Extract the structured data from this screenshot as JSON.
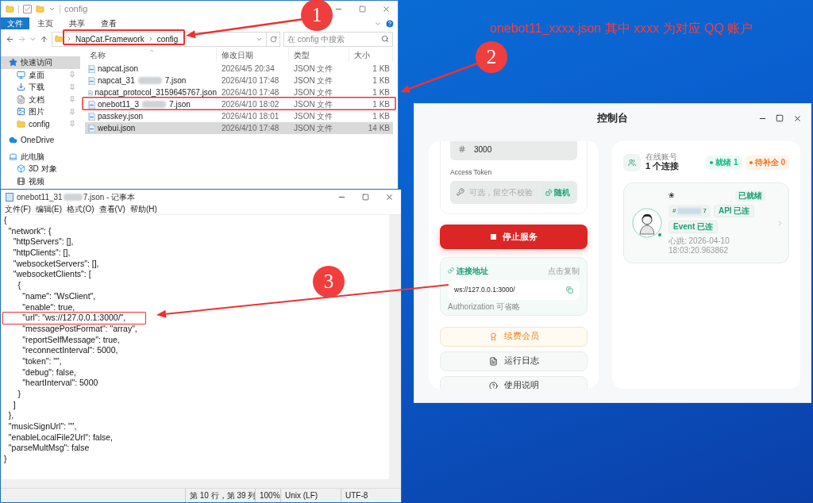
{
  "desktop": {
    "note": "onebot11_xxxx.json 其中 xxxx 为对应 QQ 账户"
  },
  "annotations": [
    {
      "number": "1"
    },
    {
      "number": "2"
    },
    {
      "number": "3"
    }
  ],
  "explorer": {
    "title": "config",
    "ribbon_tabs": [
      {
        "label": "文件",
        "selected": true
      },
      {
        "label": "主页",
        "selected": false
      },
      {
        "label": "共享",
        "selected": false
      },
      {
        "label": "查看",
        "selected": false
      }
    ],
    "breadcrumb": [
      "NapCat.Framework",
      "config"
    ],
    "search": {
      "placeholder": "在 config 中搜索"
    },
    "sidebar": [
      {
        "label": "快速访问",
        "kind": "star",
        "selected": true,
        "children": [
          {
            "label": "桌面",
            "kind": "desktop",
            "pinned": true
          },
          {
            "label": "下载",
            "kind": "download",
            "pinned": true
          },
          {
            "label": "文档",
            "kind": "document",
            "pinned": true
          },
          {
            "label": "图片",
            "kind": "picture",
            "pinned": true
          },
          {
            "label": "config",
            "kind": "folder",
            "pinned": true
          }
        ]
      },
      {
        "label": "OneDrive",
        "kind": "cloud",
        "selected": false
      },
      {
        "label": "此电脑",
        "kind": "pc",
        "selected": false,
        "children": [
          {
            "label": "3D 对象",
            "kind": "cube",
            "pinned": false
          },
          {
            "label": "视频",
            "kind": "video",
            "pinned": false
          }
        ]
      }
    ],
    "columns": [
      "名称",
      "修改日期",
      "类型",
      "大小"
    ],
    "files": [
      {
        "name": "napcat.json",
        "date": "2026/4/5 20:34",
        "type": "JSON 文件",
        "size": "1 KB",
        "selected": false
      },
      {
        "name": "napcat_31",
        "name_end": "7.json",
        "date": "2026/4/10 17:48",
        "type": "JSON 文件",
        "size": "1 KB",
        "selected": false
      },
      {
        "name": "napcat_protocol_3159645767.json",
        "date": "2026/4/10 17:48",
        "type": "JSON 文件",
        "size": "1 KB",
        "selected": false
      },
      {
        "name": "onebot11_3",
        "name_end": "7.json",
        "date": "2026/4/10 18:02",
        "type": "JSON 文件",
        "size": "1 KB",
        "selected": false
      },
      {
        "name": "passkey.json",
        "date": "2026/4/10 18:01",
        "type": "JSON 文件",
        "size": "1 KB",
        "selected": false
      },
      {
        "name": "webui.json",
        "date": "2026/4/10 17:48",
        "type": "JSON 文件",
        "size": "14 KB",
        "selected": true
      }
    ]
  },
  "notepad": {
    "title": "onebot11_31",
    "title_end": "7.json - 记事本",
    "menu": [
      "文件(F)",
      "编辑(E)",
      "格式(O)",
      "查看(V)",
      "帮助(H)"
    ],
    "lines": [
      "{",
      "  \"network\": {",
      "    \"httpServers\": [],",
      "    \"httpClients\": [],",
      "    \"websocketServers\": [],",
      "    \"websocketClients\": [",
      "      {",
      "        \"name\": \"WsClient\",",
      "        \"enable\": true,",
      "        \"url\": \"ws://127.0.0.1:3000/\",",
      "        \"messagePostFormat\": \"array\",",
      "        \"reportSelfMessage\": true,",
      "        \"reconnectInterval\": 5000,",
      "        \"token\": \"\",",
      "        \"debug\": false,",
      "        \"heartInterval\": 5000",
      "      }",
      "    ]",
      "  },",
      "  \"musicSignUrl\": \"\",",
      "  \"enableLocalFile2Url\": false,",
      "  \"parseMultMsg\": false",
      "}"
    ],
    "status": [
      "第 10 行，第 39 列",
      "100%",
      "Unix (LF)",
      "UTF-8"
    ]
  },
  "console": {
    "title": "控制台",
    "port": "3000",
    "token_label": "Access Token",
    "token": {
      "placeholder": "可选，留空不校验"
    },
    "random_button": "随机",
    "stop_button": "停止服务",
    "connection": {
      "title": "连接地址",
      "copy_hint": "点击复制",
      "url": "ws://127.0.0.1:3000/",
      "note": "Authorization 可省略"
    },
    "actions": [
      {
        "label": "续费会员",
        "kind": "premium"
      },
      {
        "label": "运行日志",
        "kind": "log"
      },
      {
        "label": "使用说明",
        "kind": "help"
      }
    ],
    "accounts": {
      "label": "在线账号",
      "count": "1 个连接",
      "badges": [
        {
          "label": "就绪 1",
          "color": "#10b981"
        },
        {
          "label": "待补全 0",
          "color": "#f97316"
        }
      ]
    },
    "account": {
      "name": "❀",
      "status": "已就绪",
      "id_start": "#",
      "id_end": "7",
      "tags": [
        "API 已连",
        "Event 已连"
      ],
      "heartbeat": "心跳: 2026-04-10 18:03:20.963862",
      "online": true
    }
  }
}
